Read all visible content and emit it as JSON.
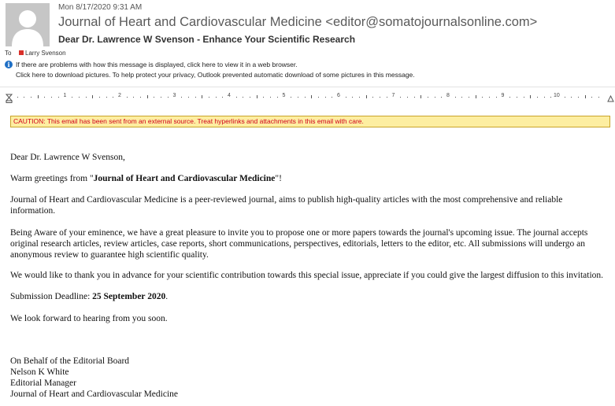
{
  "header": {
    "date": "Mon 8/17/2020 9:31 AM",
    "from": "Journal of Heart and Cardiovascular Medicine <editor@somatojournalsonline.com>",
    "subject": "Dear Dr. Lawrence W Svenson - Enhance Your Scientific Research",
    "to_label": "To",
    "to_name": "Larry Svenson",
    "info_line1": "If there are problems with how this message is displayed, click here to view it in a web browser.",
    "info_line2": "Click here to download pictures. To help protect your privacy, Outlook prevented automatic download of some pictures in this message."
  },
  "ruler": {
    "numbers": [
      "1",
      "2",
      "3",
      "4",
      "5",
      "6",
      "7",
      "8",
      "9",
      "10"
    ]
  },
  "caution": "CAUTION: This email has been sent from an external source. Treat hyperlinks and attachments in this email with care.",
  "body": {
    "greeting": "Dear Dr. Lawrence W Svenson,",
    "warm_prefix": "Warm greetings from \"",
    "journal_name": "Journal of Heart and Cardiovascular Medicine",
    "warm_suffix": "\"!",
    "para1": "Journal of Heart and Cardiovascular Medicine is a peer-reviewed journal, aims to publish high-quality articles with the most comprehensive and reliable information.",
    "para2": "Being Aware of your eminence, we have a great pleasure to invite you to propose one or more papers towards the journal's upcoming issue. The journal accepts original research articles, review articles, case reports, short communications, perspectives, editorials, letters to the editor, etc. All submissions will undergo an anonymous review to guarantee high scientific quality.",
    "para3": "We would like to thank you in advance for your scientific contribution towards this special issue, appreciate if you could give the largest diffusion to this invitation.",
    "deadline_label": "Submission Deadline: ",
    "deadline_date": "25 September 2020",
    "deadline_end": ".",
    "para4": "We look forward to hearing from you soon.",
    "sig1": "On Behalf of the Editorial Board",
    "sig2": "Nelson K White",
    "sig3": "Editorial Manager",
    "sig4": "Journal of Heart and Cardiovascular Medicine"
  },
  "colors": {
    "caution_bg": "#fdeea1",
    "caution_text": "#d1001c",
    "info_icon": "#1e6fc5"
  }
}
